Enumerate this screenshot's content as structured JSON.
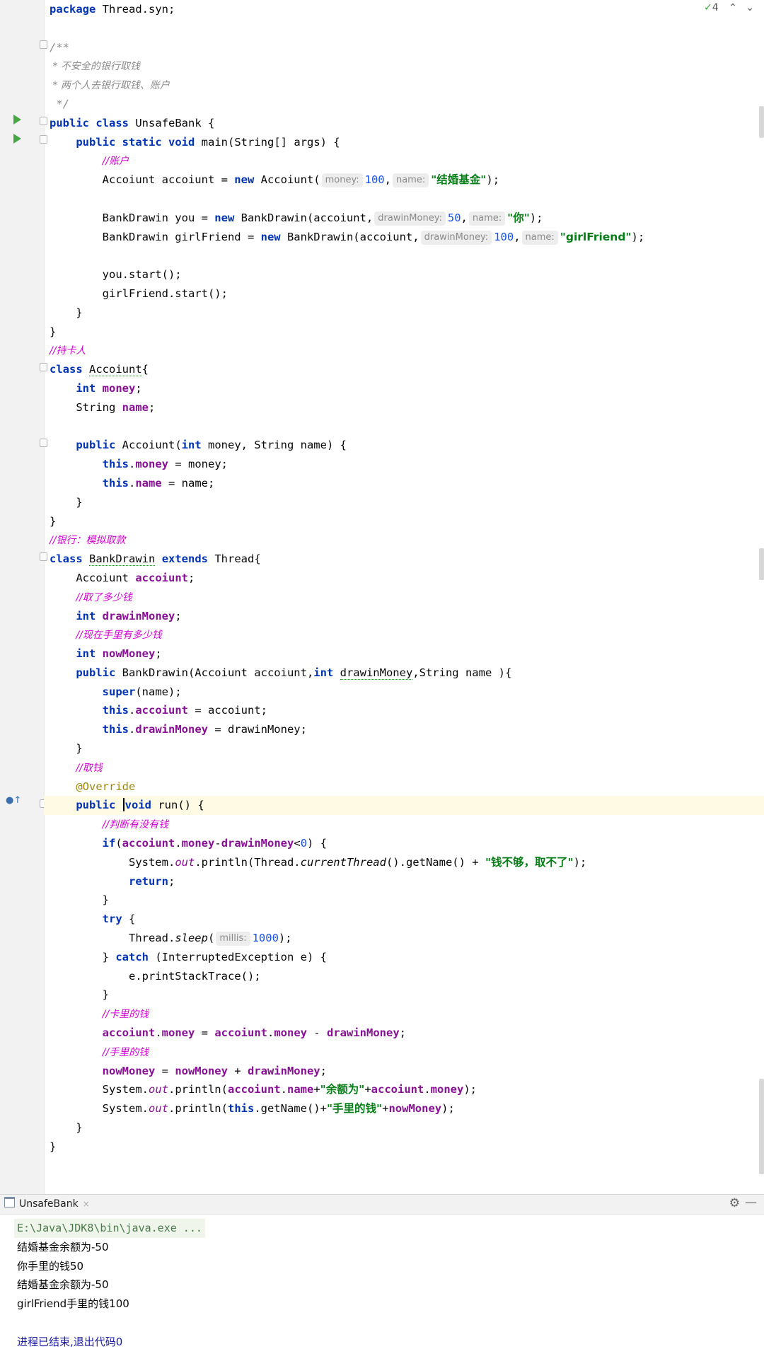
{
  "inspection": {
    "count": "4",
    "up": "⌃",
    "down": "⌄"
  },
  "tokens": {
    "package": "package",
    "public": "public",
    "class": "class",
    "static": "static",
    "void": "void",
    "new": "new",
    "int": "int",
    "this": "this",
    "extends": "extends",
    "super": "super",
    "if": "if",
    "return": "return",
    "try": "try",
    "catch": "catch"
  },
  "code": {
    "l1_pkg": " Thread.syn;",
    "l3": "/**",
    "l4": " * 不安全的银行取钱",
    "l5": " * 两个人去银行取钱、账户",
    "l6": " */",
    "classname": " UnsafeBank {",
    "main_sig": " main(String[] args) {",
    "cm_account": "//账户",
    "acc_decl": "Accoiunt accoiunt = ",
    "acc_ctor": " Accoiunt(",
    "hint_money": "money:",
    "v100": "100",
    "comma": ",",
    "hint_name": "name:",
    "s_fund": "\"结婚基金\"",
    "close_paren": ");",
    "you_decl": "BankDrawin you = ",
    "bd_ctor": " BankDrawin(accoiunt,",
    "hint_drawin": "drawinMoney:",
    "v50": "50",
    "s_you": "\"你\"",
    "gf_decl": "BankDrawin girlFriend = ",
    "s_gf": "\"girlFriend\"",
    "you_start": "you.start();",
    "gf_start": "girlFriend.start();",
    "rbrace": "}",
    "cm_holder": "//持卡人",
    "acc_cls": "Accoiunt",
    "lbrace": "{",
    "money": "money",
    "semi": ";",
    "string_t": "String ",
    "name": "name",
    "acc_ctor_name": " Accoiunt(",
    "acc_params_1": " money, String name) {",
    "dot": ".",
    "assign_money": " = money;",
    "assign_name": " = name;",
    "cm_bank": "//银行：模拟取款",
    "bd_cls": "BankDrawin",
    "thread_brace": " Thread{",
    "acc_t": "Accoiunt ",
    "accoiunt": "accoiunt",
    "cm_take": "//取了多少钱",
    "drawinMoney": "drawinMoney",
    "cm_now": "//现在手里有多少钱",
    "nowMoney": "nowMoney",
    "bd_ctor_name": " BankDrawin(Accoiunt accoiunt,",
    "bd_params_2": "drawinMoney",
    "bd_params_3": ",String name ){",
    "super_args": "(name);",
    "assign_acc": " = accoiunt;",
    "assign_dm": " = drawinMoney;",
    "cm_withdraw": "//取钱",
    "override": "@Override",
    "run_sig": " run() {",
    "cm_check": "//判断有没有钱",
    "if_open": "(",
    "minus": "-",
    "lt": "<",
    "zero": "0",
    "if_close": ") {",
    "sys": "System.",
    "out": "out",
    "println_ct": ".println(Thread.",
    "currentThread": "currentThread",
    "getname_plus": "().getName() + ",
    "s_notenough": "\"钱不够，取不了\"",
    "try_brace": " {",
    "thread_dot": "Thread.",
    "sleep": "sleep",
    "paren_open": "(",
    "hint_millis": "millis:",
    "v1000": "1000",
    "catch_rest": " (InterruptedException e) {",
    "print_trace": "e.printStackTrace();",
    "cm_card": "//卡里的钱",
    "eq": " = ",
    "minus_sp": " - ",
    "cm_hand": "//手里的钱",
    "plus_sp": " + ",
    "println_open": ".println(",
    "plus": "+",
    "s_balance": "\"余额为\"",
    "getname": ".getName()+",
    "s_inhand": "\"手里的钱\"",
    "end_paren": ");"
  },
  "run_panel": {
    "tab_label": "UnsafeBank",
    "tab_close": "×",
    "settings_icon": "⚙",
    "minimize_icon": "—",
    "lines": [
      "E:\\Java\\JDK8\\bin\\java.exe ...",
      "结婚基金余额为-50",
      "你手里的钱50",
      "结婚基金余额为-50",
      "girlFriend手里的钱100",
      "",
      "进程已结束,退出代码0"
    ]
  },
  "colors": {
    "keyword": "#0033b3",
    "field": "#871094",
    "number": "#1750eb",
    "string": "#067d17",
    "line_comment": "#d000d0",
    "annotation": "#9e880d",
    "run_icon": "#45a845",
    "current_line": "#fefae3"
  }
}
